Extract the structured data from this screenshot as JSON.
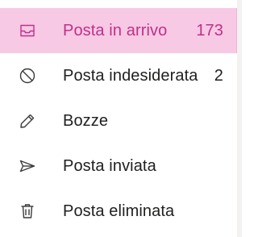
{
  "colors": {
    "selected_background": "#f7c9e4",
    "selected_text": "#c0308a",
    "default_text": "#201f1e",
    "icon_color": "#3b3a39"
  },
  "folders": [
    {
      "label": "Posta in arrivo",
      "count": "173",
      "icon": "inbox-icon",
      "selected": true
    },
    {
      "label": "Posta indesiderata",
      "count": "2",
      "icon": "block-icon",
      "selected": false
    },
    {
      "label": "Bozze",
      "count": "",
      "icon": "pencil-icon",
      "selected": false
    },
    {
      "label": "Posta inviata",
      "count": "",
      "icon": "send-icon",
      "selected": false
    },
    {
      "label": "Posta eliminata",
      "count": "",
      "icon": "trash-icon",
      "selected": false
    }
  ]
}
